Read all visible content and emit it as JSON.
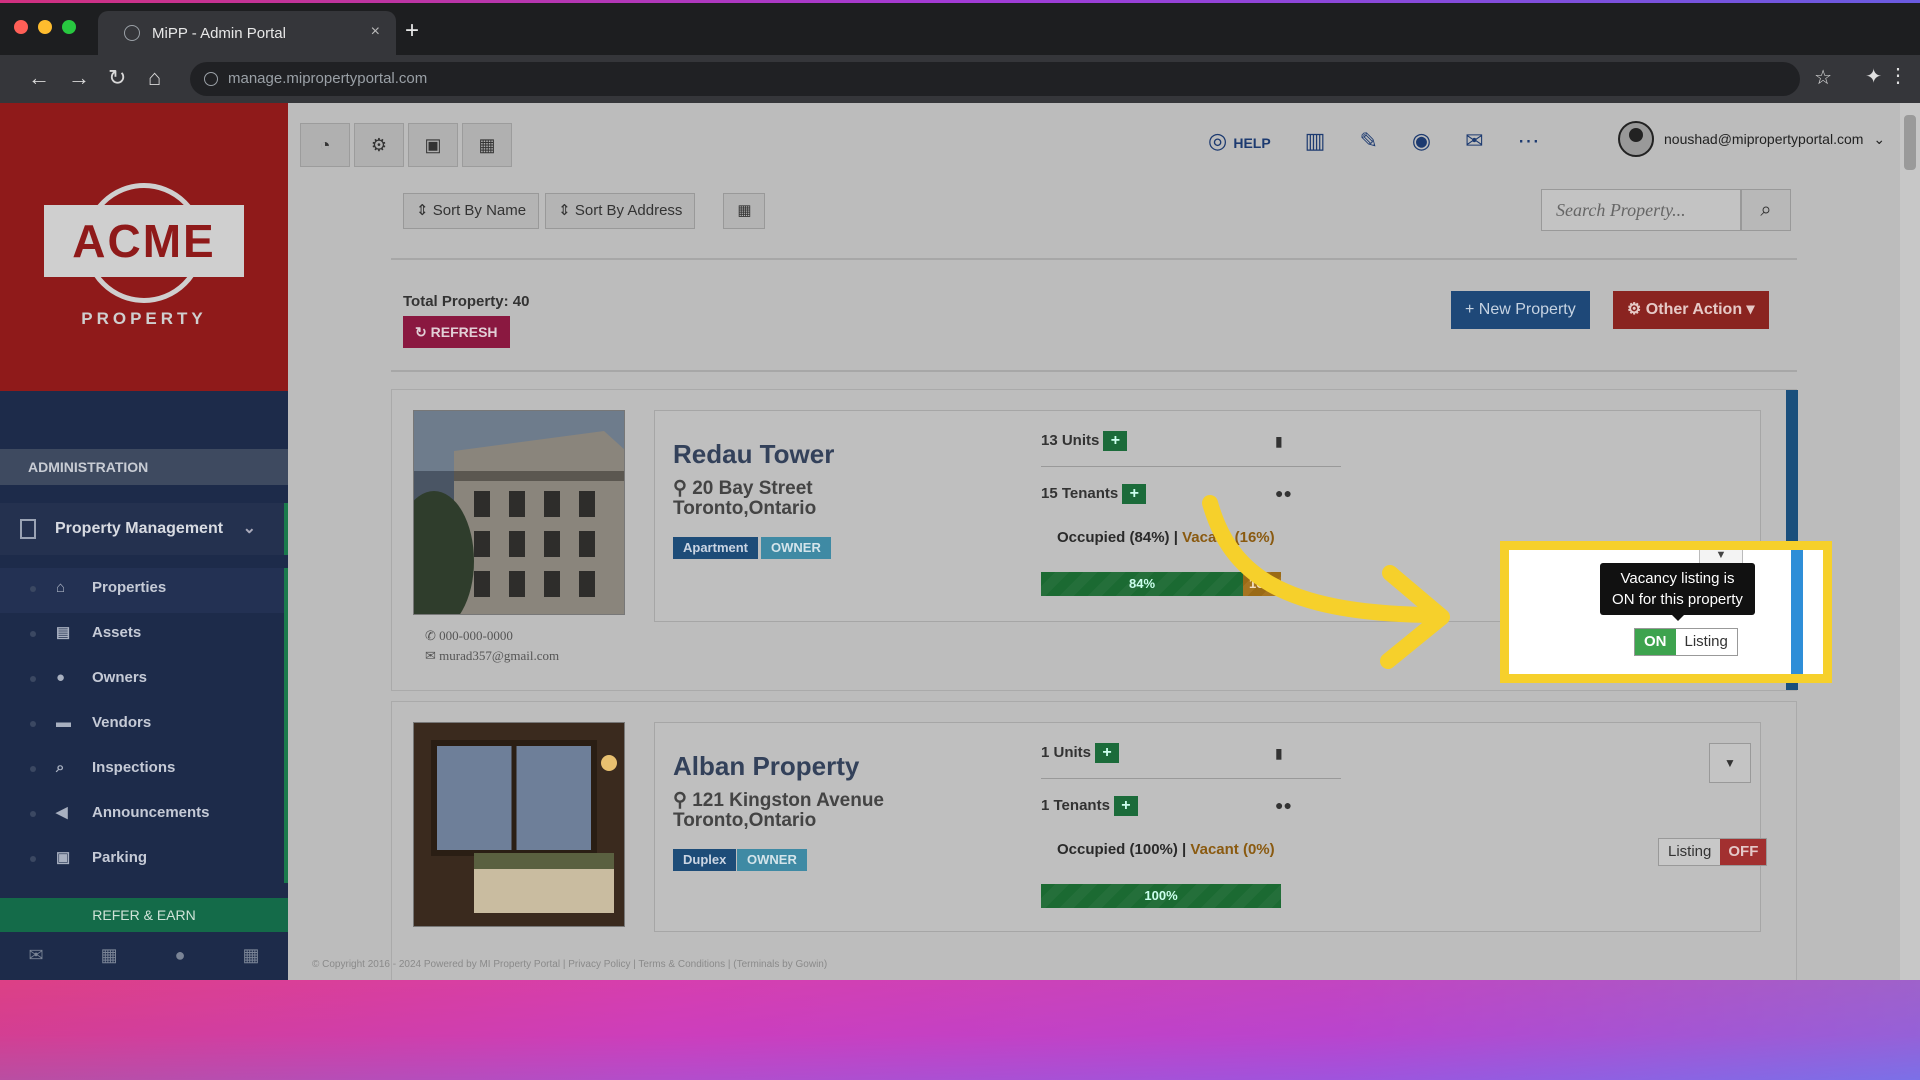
{
  "browser": {
    "tab_title": "MiPP - Admin Portal",
    "tab_close": "×",
    "new_tab": "+",
    "url": "manage.mipropertyportal.com"
  },
  "sidebar": {
    "logo_text": "ACME",
    "logo_sub": "PROPERTY",
    "section_header": "ADMINISTRATION",
    "group_label": "Property Management",
    "items": [
      {
        "label": "Properties",
        "icon": "home-icon"
      },
      {
        "label": "Assets",
        "icon": "box-icon"
      },
      {
        "label": "Owners",
        "icon": "user-icon"
      },
      {
        "label": "Vendors",
        "icon": "briefcase-icon"
      },
      {
        "label": "Inspections",
        "icon": "search-icon"
      },
      {
        "label": "Announcements",
        "icon": "megaphone-icon"
      },
      {
        "label": "Parking",
        "icon": "car-icon"
      }
    ],
    "refer_label": "REFER & EARN"
  },
  "topbar": {
    "help_label": "HELP",
    "user_email": "noushad@mipropertyportal.com"
  },
  "toolbar": {
    "sort_name": "Sort By Name",
    "sort_address": "Sort By Address",
    "search_placeholder": "Search Property..."
  },
  "summary": {
    "total_label": "Total Property: 40",
    "refresh_label": "REFRESH",
    "new_property_label": "New Property",
    "other_action_label": "Other Action"
  },
  "properties": [
    {
      "name": "Redau Tower",
      "address_line1": "20 Bay Street",
      "address_line2": "Toronto,Ontario",
      "type": "Apartment",
      "role": "OWNER",
      "units": "13 Units",
      "tenants": "15 Tenants",
      "occupied": "Occupied (84%)",
      "vacant": "Vacant (16%)",
      "occupied_pct": 84,
      "occupied_bar": "84%",
      "vacant_bar": "16%",
      "phone": "000-000-0000",
      "email": "murad357@gmail.com",
      "listing_state": "ON",
      "listing_label": "Listing"
    },
    {
      "name": "Alban Property",
      "address_line1": "121 Kingston Avenue",
      "address_line2": "Toronto,Ontario",
      "type": "Duplex",
      "role": "OWNER",
      "units": "1 Units",
      "tenants": "1 Tenants",
      "occupied": "Occupied (100%)",
      "vacant": "Vacant (0%)",
      "occupied_pct": 100,
      "occupied_bar": "100%",
      "listing_state": "OFF",
      "listing_label": "Listing"
    }
  ],
  "tooltip": {
    "line1": "Vacancy listing is",
    "line2": "ON for this property"
  },
  "footer": {
    "text": "© Copyright 2016 - 2024 Powered by MI Property Portal | Privacy Policy | Terms & Conditions | (Terminals by Gowin)"
  },
  "colors": {
    "highlight": "#f6d02b",
    "listing_on": "#3da34e",
    "listing_off": "#a23030",
    "accent_blue": "#2e8ed8"
  }
}
